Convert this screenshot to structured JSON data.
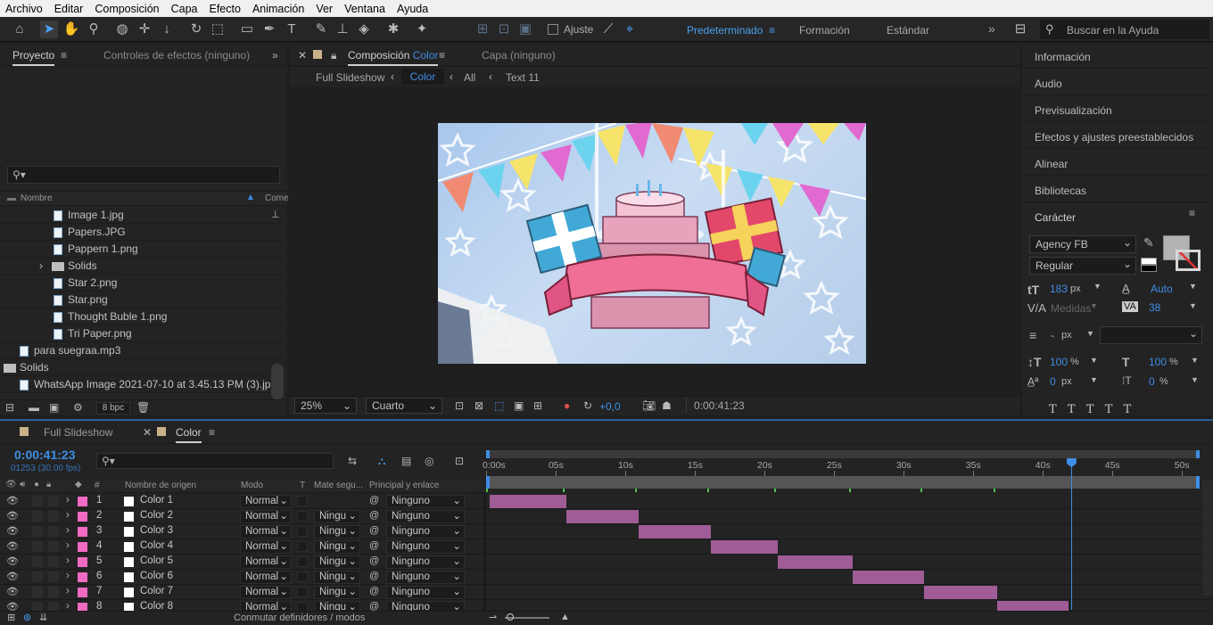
{
  "menu": [
    "Archivo",
    "Editar",
    "Composición",
    "Capa",
    "Efecto",
    "Animación",
    "Ver",
    "Ventana",
    "Ayuda"
  ],
  "toolbar": {
    "snap_label": "Ajuste",
    "workspaces": [
      "Predeterminado",
      "Formación",
      "Estándar"
    ],
    "active_workspace": "Predeterminado",
    "help_placeholder": "Buscar en la Ayuda"
  },
  "project": {
    "tab_project": "Proyecto",
    "tab_effects": "Controles de efectos (ninguno)",
    "col_name": "Nombre",
    "col_comment": "Come",
    "files": [
      {
        "name": "Image 1.jpg",
        "type": "image",
        "indent": 2
      },
      {
        "name": "Papers.JPG",
        "type": "image",
        "indent": 2
      },
      {
        "name": "Pappern 1.png",
        "type": "image",
        "indent": 2
      },
      {
        "name": "Solids",
        "type": "folder",
        "indent": 2
      },
      {
        "name": "Star 2.png",
        "type": "image",
        "indent": 2
      },
      {
        "name": "Star.png",
        "type": "image",
        "indent": 2
      },
      {
        "name": "Thought Buble 1.png",
        "type": "image",
        "indent": 2
      },
      {
        "name": "Tri Paper.png",
        "type": "image",
        "indent": 2
      },
      {
        "name": "para suegraa.mp3",
        "type": "audio",
        "indent": 1
      },
      {
        "name": "Solids",
        "type": "folder",
        "indent": 0
      },
      {
        "name": "WhatsApp Image 2021-07-10 at 3.45.13 PM (3).jpg",
        "type": "image",
        "indent": 1
      }
    ],
    "bpc": "8 bpc"
  },
  "composition": {
    "tab_prefix": "Composición",
    "tab_name": "Color",
    "layer_tab": "Capa (ninguno)",
    "breadcrumbs": [
      "Full Slideshow",
      "Color",
      "All",
      "Text 11"
    ],
    "zoom": "25%",
    "resolution": "Cuarto",
    "exposure": "+0,0",
    "timecode": "0:00:41:23"
  },
  "right_panel": {
    "items": [
      "Información",
      "Audio",
      "Previsualización",
      "Efectos y ajustes preestablecidos",
      "Alinear",
      "Bibliotecas",
      "Carácter"
    ],
    "font": "Agency FB",
    "style": "Regular",
    "size": "183",
    "size_unit": "px",
    "leading": "Auto",
    "kerning": "Medidas",
    "tracking": "38",
    "stroke": "-",
    "stroke_unit": "px",
    "vscale": "100",
    "hscale": "100",
    "baseline": "0",
    "baseline_unit": "px",
    "tsume": "0",
    "pct": "%",
    "px": "px",
    "fill_color": "#b3b3b3"
  },
  "timeline": {
    "tabs": [
      "Full Slideshow",
      "Color"
    ],
    "timecode": "0:00:41:23",
    "frames": "01253 (30.00 fps)",
    "col_source": "Nombre de origen",
    "col_mode": "Modo",
    "col_t": "T",
    "col_matte": "Mate segu...",
    "col_parent": "Principal y enlace",
    "ruler": [
      "0:00s",
      "05s",
      "10s",
      "15s",
      "20s",
      "25s",
      "30s",
      "35s",
      "40s",
      "45s",
      "50s"
    ],
    "toggle_label": "Conmutar definidores / modos",
    "layers": [
      {
        "num": "1",
        "name": "Color 1",
        "mode": "Normal",
        "matte": "",
        "parent": "Ninguno",
        "start": 0,
        "end": 5.5
      },
      {
        "num": "2",
        "name": "Color 2",
        "mode": "Normal",
        "matte": "Ningu",
        "parent": "Ninguno",
        "start": 5.5,
        "end": 10.7
      },
      {
        "num": "3",
        "name": "Color 3",
        "mode": "Normal",
        "matte": "Ningu",
        "parent": "Ninguno",
        "start": 10.7,
        "end": 15.9
      },
      {
        "num": "4",
        "name": "Color 4",
        "mode": "Normal",
        "matte": "Ningu",
        "parent": "Ninguno",
        "start": 15.9,
        "end": 20.7
      },
      {
        "num": "5",
        "name": "Color 5",
        "mode": "Normal",
        "matte": "Ningu",
        "parent": "Ninguno",
        "start": 20.7,
        "end": 26.1
      },
      {
        "num": "6",
        "name": "Color 6",
        "mode": "Normal",
        "matte": "Ningu",
        "parent": "Ninguno",
        "start": 26.1,
        "end": 31.2
      },
      {
        "num": "7",
        "name": "Color 7",
        "mode": "Normal",
        "matte": "Ningu",
        "parent": "Ninguno",
        "start": 31.2,
        "end": 36.5
      },
      {
        "num": "8",
        "name": "Color 8",
        "mode": "Normal",
        "matte": "Ningu",
        "parent": "Ninguno",
        "start": 36.5,
        "end": 41.6
      }
    ],
    "playhead_seconds": 41.8,
    "layer_color": "#f06ac3",
    "bar_color": "#a05c96"
  }
}
